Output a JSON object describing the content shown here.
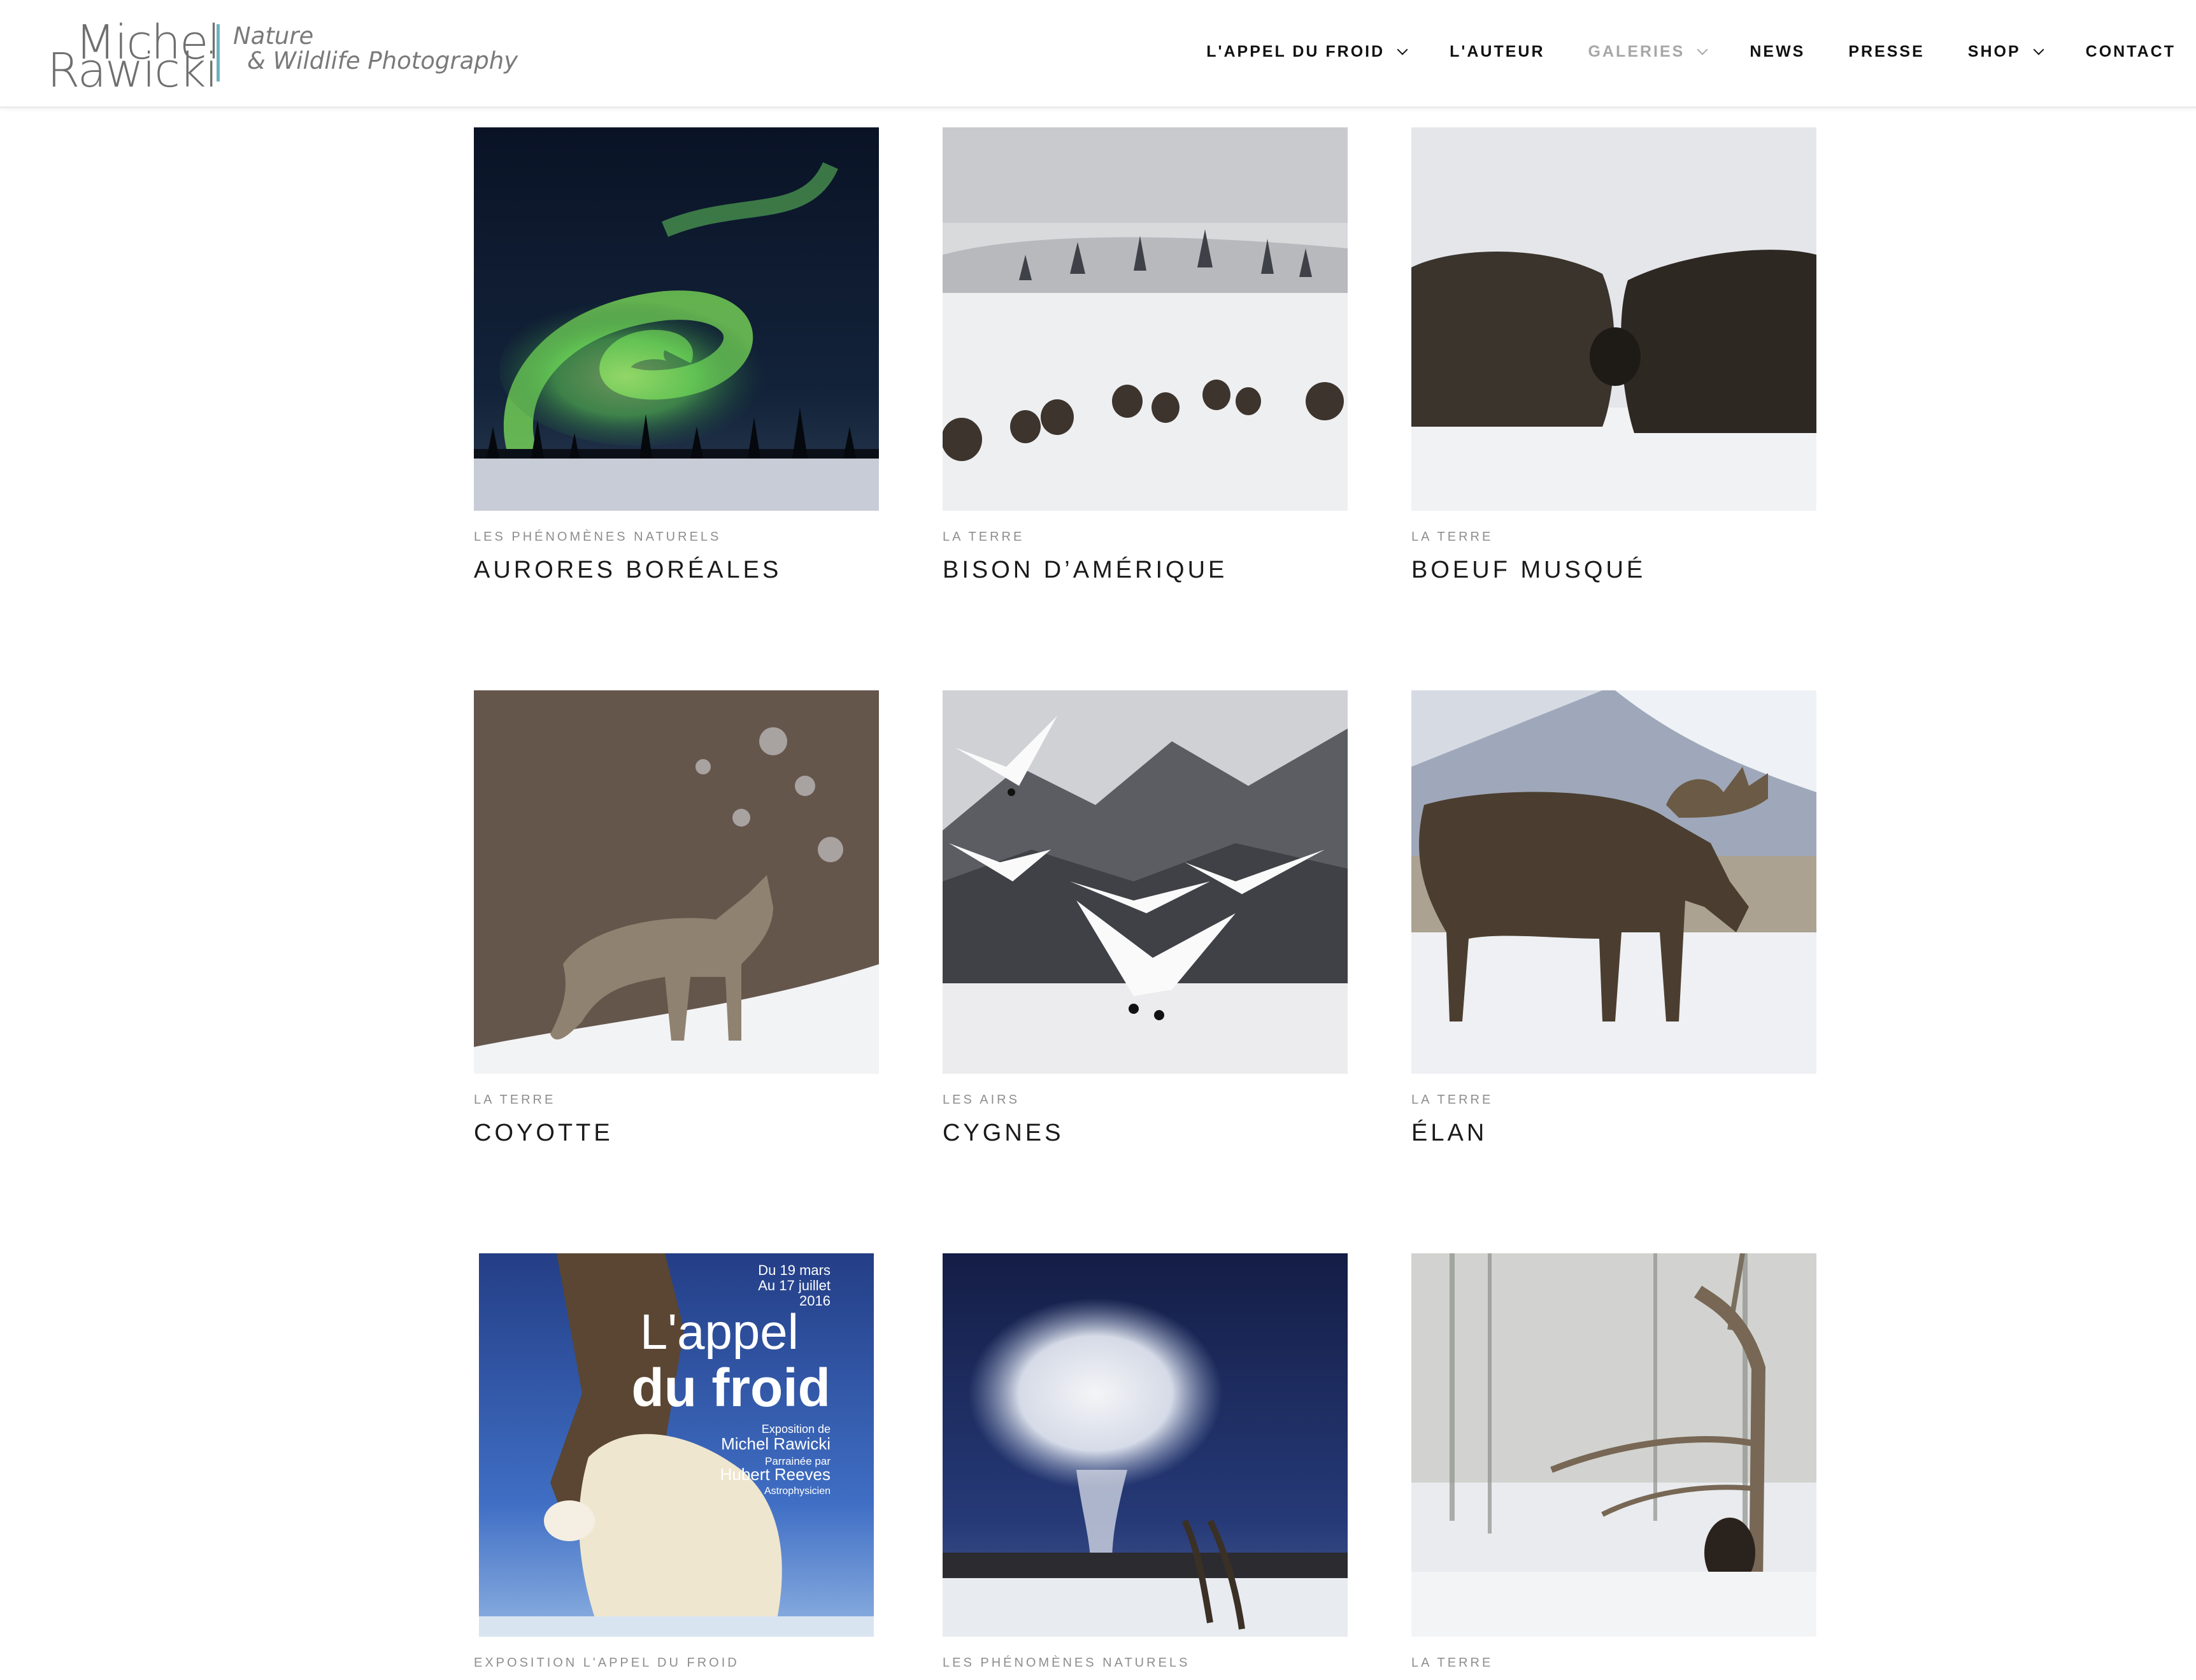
{
  "brand": {
    "name_first": "Michel",
    "name_last": "Rawicki",
    "tagline_1": "Nature",
    "tagline_2": "& Wildlife Photography",
    "accent_color": "#6fb3bd"
  },
  "nav": {
    "items": [
      {
        "label": "L'APPEL DU FROID",
        "has_dropdown": true,
        "active": false
      },
      {
        "label": "L'AUTEUR",
        "has_dropdown": false,
        "active": false
      },
      {
        "label": "GALERIES",
        "has_dropdown": true,
        "active": true
      },
      {
        "label": "NEWS",
        "has_dropdown": false,
        "active": false
      },
      {
        "label": "PRESSE",
        "has_dropdown": false,
        "active": false
      },
      {
        "label": "SHOP",
        "has_dropdown": true,
        "active": false
      },
      {
        "label": "CONTACT",
        "has_dropdown": false,
        "active": false
      }
    ]
  },
  "gallery": {
    "items": [
      {
        "category": "LES PHÉNOMÈNES NATURELS",
        "title": "AURORES BORÉALES",
        "image": "aurora"
      },
      {
        "category": "LA TERRE",
        "title": "BISON D’AMÉRIQUE",
        "image": "bison"
      },
      {
        "category": "LA TERRE",
        "title": "BOEUF MUSQUÉ",
        "image": "muskox"
      },
      {
        "category": "LA TERRE",
        "title": "COYOTTE",
        "image": "coyote"
      },
      {
        "category": "LES AIRS",
        "title": "CYGNES",
        "image": "swans"
      },
      {
        "category": "LA TERRE",
        "title": "ÉLAN",
        "image": "moose"
      },
      {
        "category": "EXPOSITION L'APPEL DU FROID",
        "title": "",
        "image": "poster"
      },
      {
        "category": "LES PHÉNOMÈNES NATURELS",
        "title": "",
        "image": "geyser"
      },
      {
        "category": "LA TERRE",
        "title": "",
        "image": "wolverine"
      }
    ]
  },
  "poster": {
    "date_1": "Du 19 mars",
    "date_2": "Au 17 juillet",
    "date_3": "2016",
    "title_1": "L'appel",
    "title_2": "du froid",
    "line_1": "Exposition de",
    "line_2": "Michel Rawicki",
    "line_3": "Parrainée par",
    "line_4": "Hubert Reeves",
    "line_5": "Astrophysicien"
  }
}
